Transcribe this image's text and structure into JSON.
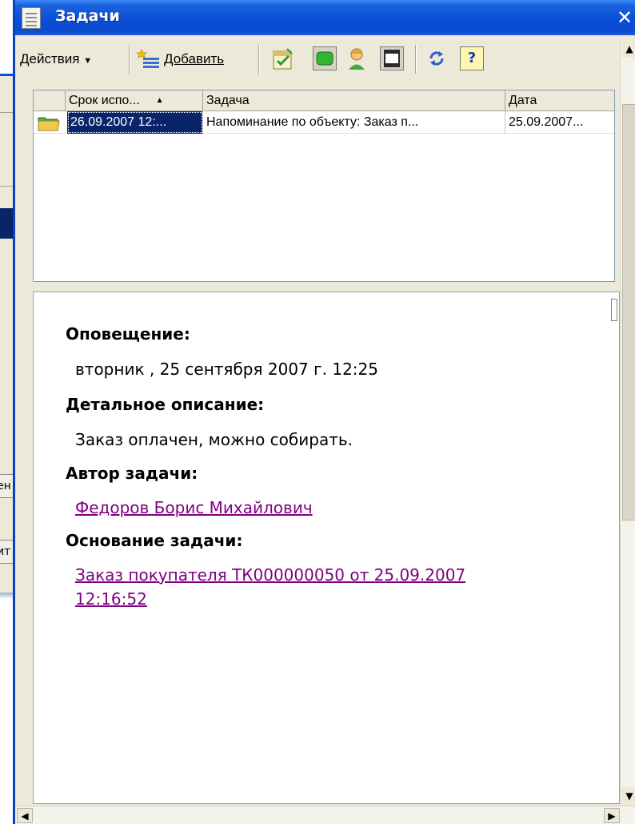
{
  "window": {
    "title": "Задачи",
    "close": "✕"
  },
  "toolbar": {
    "actions_label": "Действия",
    "add_label": "Добавить",
    "help": "?"
  },
  "background": {
    "btn1": "ен",
    "btn2": "ит"
  },
  "table": {
    "columns": [
      "Срок испо...",
      "Задача",
      "Дата"
    ],
    "sort_indicator": "▲",
    "rows": [
      {
        "deadline": "26.09.2007 12:...",
        "task": "Напоминание по объекту: Заказ п...",
        "date": "25.09.2007..."
      }
    ]
  },
  "details": {
    "notification_label": "Оповещение:",
    "notification_value": "вторник , 25 сентября 2007 г. 12:25",
    "description_label": "Детальное описание:",
    "description_value": "Заказ оплачен, можно собирать.",
    "author_label": "Автор задачи:",
    "author_value": "Федоров Борис Михайлович",
    "basis_label": "Основание задачи:",
    "basis_value": "Заказ покупателя ТК000000050 от 25.09.2007 12:16:52"
  },
  "colors": {
    "titlebar": "#0b4fd6",
    "selection": "#0a246a",
    "link_visited": "#800080",
    "chrome": "#ece9d8"
  },
  "icons": [
    "document-icon",
    "add-icon",
    "checklist-icon",
    "green-square-icon",
    "user-icon",
    "frame-icon",
    "refresh-icon",
    "help-icon",
    "folder-icon"
  ]
}
